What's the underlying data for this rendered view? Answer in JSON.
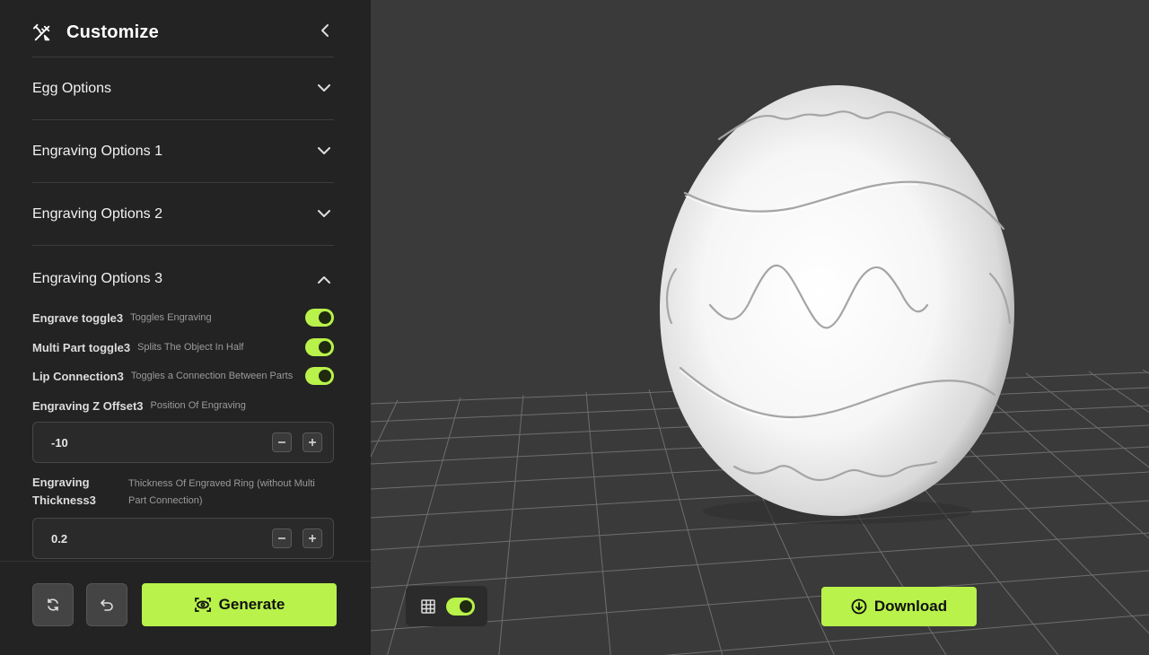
{
  "sidebar": {
    "title": "Customize",
    "sections": [
      {
        "label": "Egg Options",
        "expanded": false
      },
      {
        "label": "Engraving Options 1",
        "expanded": false
      },
      {
        "label": "Engraving Options 2",
        "expanded": false
      },
      {
        "label": "Engraving Options 3",
        "expanded": true
      }
    ],
    "options": [
      {
        "name": "Engrave toggle3",
        "desc": "Toggles Engraving",
        "on": true
      },
      {
        "name": "Multi Part toggle3",
        "desc": "Splits The Object In Half",
        "on": true
      },
      {
        "name": "Lip Connection3",
        "desc": "Toggles a Connection Between Parts",
        "on": true
      }
    ],
    "z_offset": {
      "name": "Engraving Z Offset3",
      "desc": "Position Of Engraving",
      "value": "-10"
    },
    "thickness": {
      "name": "Engraving Thickness3",
      "desc": "Thickness Of Engraved Ring (without Multi Part Connection)",
      "value": "0.2"
    },
    "generate_label": "Generate"
  },
  "viewport": {
    "grid_on": true,
    "download_label": "Download"
  },
  "colors": {
    "accent": "#b8f24a",
    "sidebar_bg": "#232323",
    "viewport_bg": "#3a3a3a"
  }
}
